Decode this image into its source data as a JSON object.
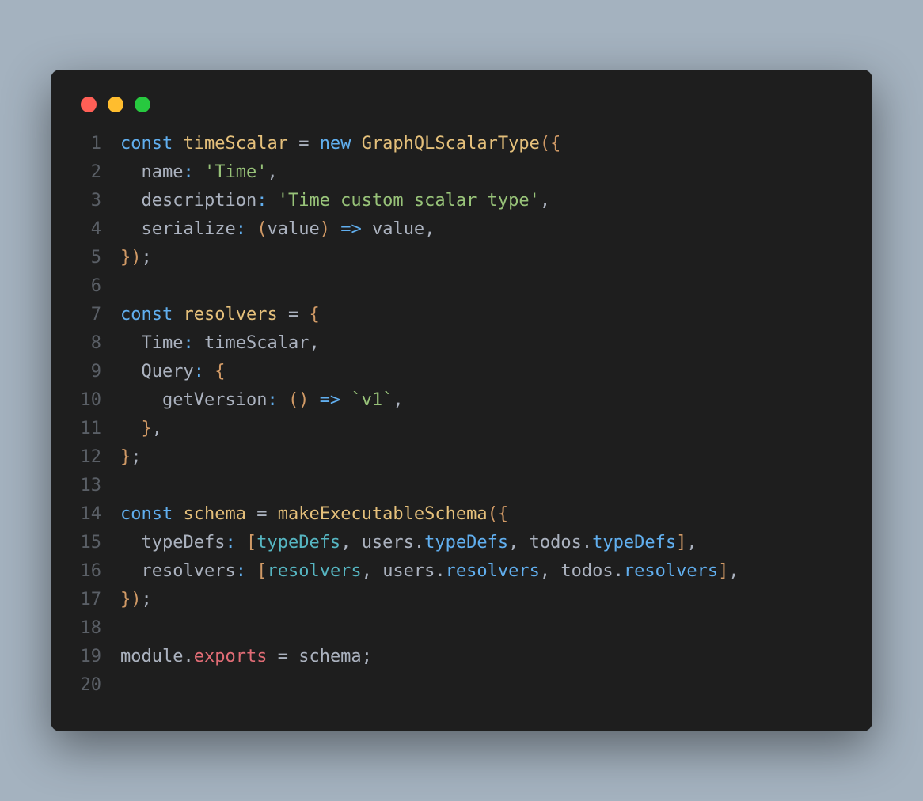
{
  "window": {
    "traffic_lights": [
      "red",
      "yellow",
      "green"
    ]
  },
  "code": {
    "lines": [
      {
        "n": "1",
        "tokens": [
          [
            "kw",
            "const"
          ],
          [
            "",
            ""
          ],
          [
            "def",
            " timeScalar"
          ],
          [
            "",
            " "
          ],
          [
            "op",
            "="
          ],
          [
            "",
            " "
          ],
          [
            "kw",
            "new"
          ],
          [
            "",
            " "
          ],
          [
            "fn",
            "GraphQLScalarType"
          ],
          [
            "paren",
            "({"
          ]
        ]
      },
      {
        "n": "2",
        "tokens": [
          [
            "",
            "  "
          ],
          [
            "prop",
            "name"
          ],
          [
            "colon",
            ":"
          ],
          [
            "",
            " "
          ],
          [
            "str",
            "'Time'"
          ],
          [
            "punct",
            ","
          ]
        ]
      },
      {
        "n": "3",
        "tokens": [
          [
            "",
            "  "
          ],
          [
            "prop",
            "description"
          ],
          [
            "colon",
            ":"
          ],
          [
            "",
            " "
          ],
          [
            "str",
            "'Time custom scalar type'"
          ],
          [
            "punct",
            ","
          ]
        ]
      },
      {
        "n": "4",
        "tokens": [
          [
            "",
            "  "
          ],
          [
            "prop",
            "serialize"
          ],
          [
            "colon",
            ":"
          ],
          [
            "",
            " "
          ],
          [
            "paren",
            "("
          ],
          [
            "obj",
            "value"
          ],
          [
            "paren",
            ")"
          ],
          [
            "",
            " "
          ],
          [
            "arrow",
            "=>"
          ],
          [
            "",
            " "
          ],
          [
            "obj",
            "value"
          ],
          [
            "punct",
            ","
          ]
        ]
      },
      {
        "n": "5",
        "tokens": [
          [
            "paren",
            "})"
          ],
          [
            "punct",
            ";"
          ]
        ]
      },
      {
        "n": "6",
        "tokens": []
      },
      {
        "n": "7",
        "tokens": [
          [
            "kw",
            "const"
          ],
          [
            "",
            " "
          ],
          [
            "def",
            "resolvers"
          ],
          [
            "",
            " "
          ],
          [
            "op",
            "="
          ],
          [
            "",
            " "
          ],
          [
            "paren",
            "{"
          ]
        ]
      },
      {
        "n": "8",
        "tokens": [
          [
            "",
            "  "
          ],
          [
            "prop",
            "Time"
          ],
          [
            "colon",
            ":"
          ],
          [
            "",
            " "
          ],
          [
            "obj",
            "timeScalar"
          ],
          [
            "punct",
            ","
          ]
        ]
      },
      {
        "n": "9",
        "tokens": [
          [
            "",
            "  "
          ],
          [
            "prop",
            "Query"
          ],
          [
            "colon",
            ":"
          ],
          [
            "",
            " "
          ],
          [
            "paren",
            "{"
          ]
        ]
      },
      {
        "n": "10",
        "tokens": [
          [
            "",
            "    "
          ],
          [
            "prop",
            "getVersion"
          ],
          [
            "colon",
            ":"
          ],
          [
            "",
            " "
          ],
          [
            "paren",
            "()"
          ],
          [
            "",
            " "
          ],
          [
            "arrow",
            "=>"
          ],
          [
            "",
            " "
          ],
          [
            "str",
            "`v1`"
          ],
          [
            "punct",
            ","
          ]
        ]
      },
      {
        "n": "11",
        "tokens": [
          [
            "",
            "  "
          ],
          [
            "paren",
            "}"
          ],
          [
            "punct",
            ","
          ]
        ]
      },
      {
        "n": "12",
        "tokens": [
          [
            "paren",
            "}"
          ],
          [
            "punct",
            ";"
          ]
        ]
      },
      {
        "n": "13",
        "tokens": []
      },
      {
        "n": "14",
        "tokens": [
          [
            "kw",
            "const"
          ],
          [
            "",
            " "
          ],
          [
            "def",
            "schema"
          ],
          [
            "",
            " "
          ],
          [
            "op",
            "="
          ],
          [
            "",
            " "
          ],
          [
            "fn",
            "makeExecutableSchema"
          ],
          [
            "paren",
            "({"
          ]
        ]
      },
      {
        "n": "15",
        "tokens": [
          [
            "",
            "  "
          ],
          [
            "prop",
            "typeDefs"
          ],
          [
            "colon",
            ":"
          ],
          [
            "",
            " "
          ],
          [
            "paren",
            "["
          ],
          [
            "ident",
            "typeDefs"
          ],
          [
            "punct",
            ", "
          ],
          [
            "obj",
            "users"
          ],
          [
            "punct",
            "."
          ],
          [
            "mem",
            "typeDefs"
          ],
          [
            "punct",
            ", "
          ],
          [
            "obj",
            "todos"
          ],
          [
            "punct",
            "."
          ],
          [
            "mem",
            "typeDefs"
          ],
          [
            "paren",
            "]"
          ],
          [
            "punct",
            ","
          ]
        ]
      },
      {
        "n": "16",
        "tokens": [
          [
            "",
            "  "
          ],
          [
            "prop",
            "resolvers"
          ],
          [
            "colon",
            ":"
          ],
          [
            "",
            " "
          ],
          [
            "paren",
            "["
          ],
          [
            "ident",
            "resolvers"
          ],
          [
            "punct",
            ", "
          ],
          [
            "obj",
            "users"
          ],
          [
            "punct",
            "."
          ],
          [
            "mem",
            "resolvers"
          ],
          [
            "punct",
            ", "
          ],
          [
            "obj",
            "todos"
          ],
          [
            "punct",
            "."
          ],
          [
            "mem",
            "resolvers"
          ],
          [
            "paren",
            "]"
          ],
          [
            "punct",
            ","
          ]
        ]
      },
      {
        "n": "17",
        "tokens": [
          [
            "paren",
            "})"
          ],
          [
            "punct",
            ";"
          ]
        ]
      },
      {
        "n": "18",
        "tokens": []
      },
      {
        "n": "19",
        "tokens": [
          [
            "obj",
            "module"
          ],
          [
            "punct",
            "."
          ],
          [
            "modkw",
            "exports"
          ],
          [
            "",
            " "
          ],
          [
            "op",
            "="
          ],
          [
            "",
            " "
          ],
          [
            "obj",
            "schema"
          ],
          [
            "punct",
            ";"
          ]
        ]
      },
      {
        "n": "20",
        "tokens": []
      }
    ]
  }
}
